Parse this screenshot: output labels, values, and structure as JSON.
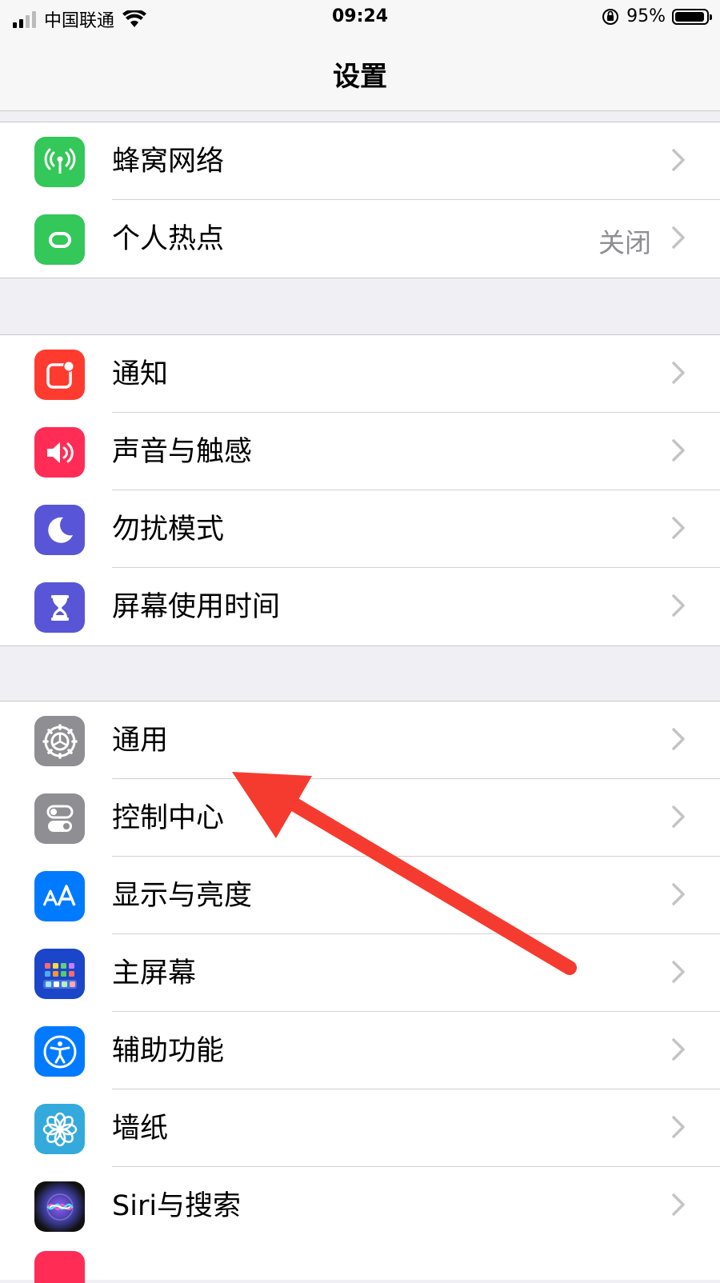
{
  "status_bar": {
    "carrier": "中国联通",
    "time": "09:24",
    "battery_percent": "95%",
    "battery_level": 0.95
  },
  "nav": {
    "title": "设置"
  },
  "groups": [
    {
      "rows": [
        {
          "label": "蜂窝网络",
          "icon": "cellular-antenna-icon",
          "color": "#34c759"
        },
        {
          "label": "个人热点",
          "value": "关闭",
          "icon": "hotspot-link-icon",
          "color": "#34c759"
        }
      ]
    },
    {
      "rows": [
        {
          "label": "通知",
          "icon": "notifications-icon",
          "color": "#ff3b30"
        },
        {
          "label": "声音与触感",
          "icon": "speaker-icon",
          "color": "#ff2d55"
        },
        {
          "label": "勿扰模式",
          "icon": "moon-icon",
          "color": "#5856d6"
        },
        {
          "label": "屏幕使用时间",
          "icon": "hourglass-icon",
          "color": "#5856d6"
        }
      ]
    },
    {
      "rows": [
        {
          "label": "通用",
          "icon": "gear-icon",
          "color": "#8e8e93"
        },
        {
          "label": "控制中心",
          "icon": "toggles-icon",
          "color": "#8e8e93"
        },
        {
          "label": "显示与亮度",
          "icon": "text-size-icon",
          "color": "#007aff"
        },
        {
          "label": "主屏幕",
          "icon": "home-grid-icon",
          "color": "#1c46c9"
        },
        {
          "label": "辅助功能",
          "icon": "accessibility-icon",
          "color": "#007aff"
        },
        {
          "label": "墙纸",
          "icon": "flower-icon",
          "color": "#34aadc"
        },
        {
          "label": "Siri与搜索",
          "icon": "siri-icon",
          "color": "#222222"
        }
      ]
    }
  ],
  "annotation": {
    "arrow_color": "#f53b2f"
  }
}
